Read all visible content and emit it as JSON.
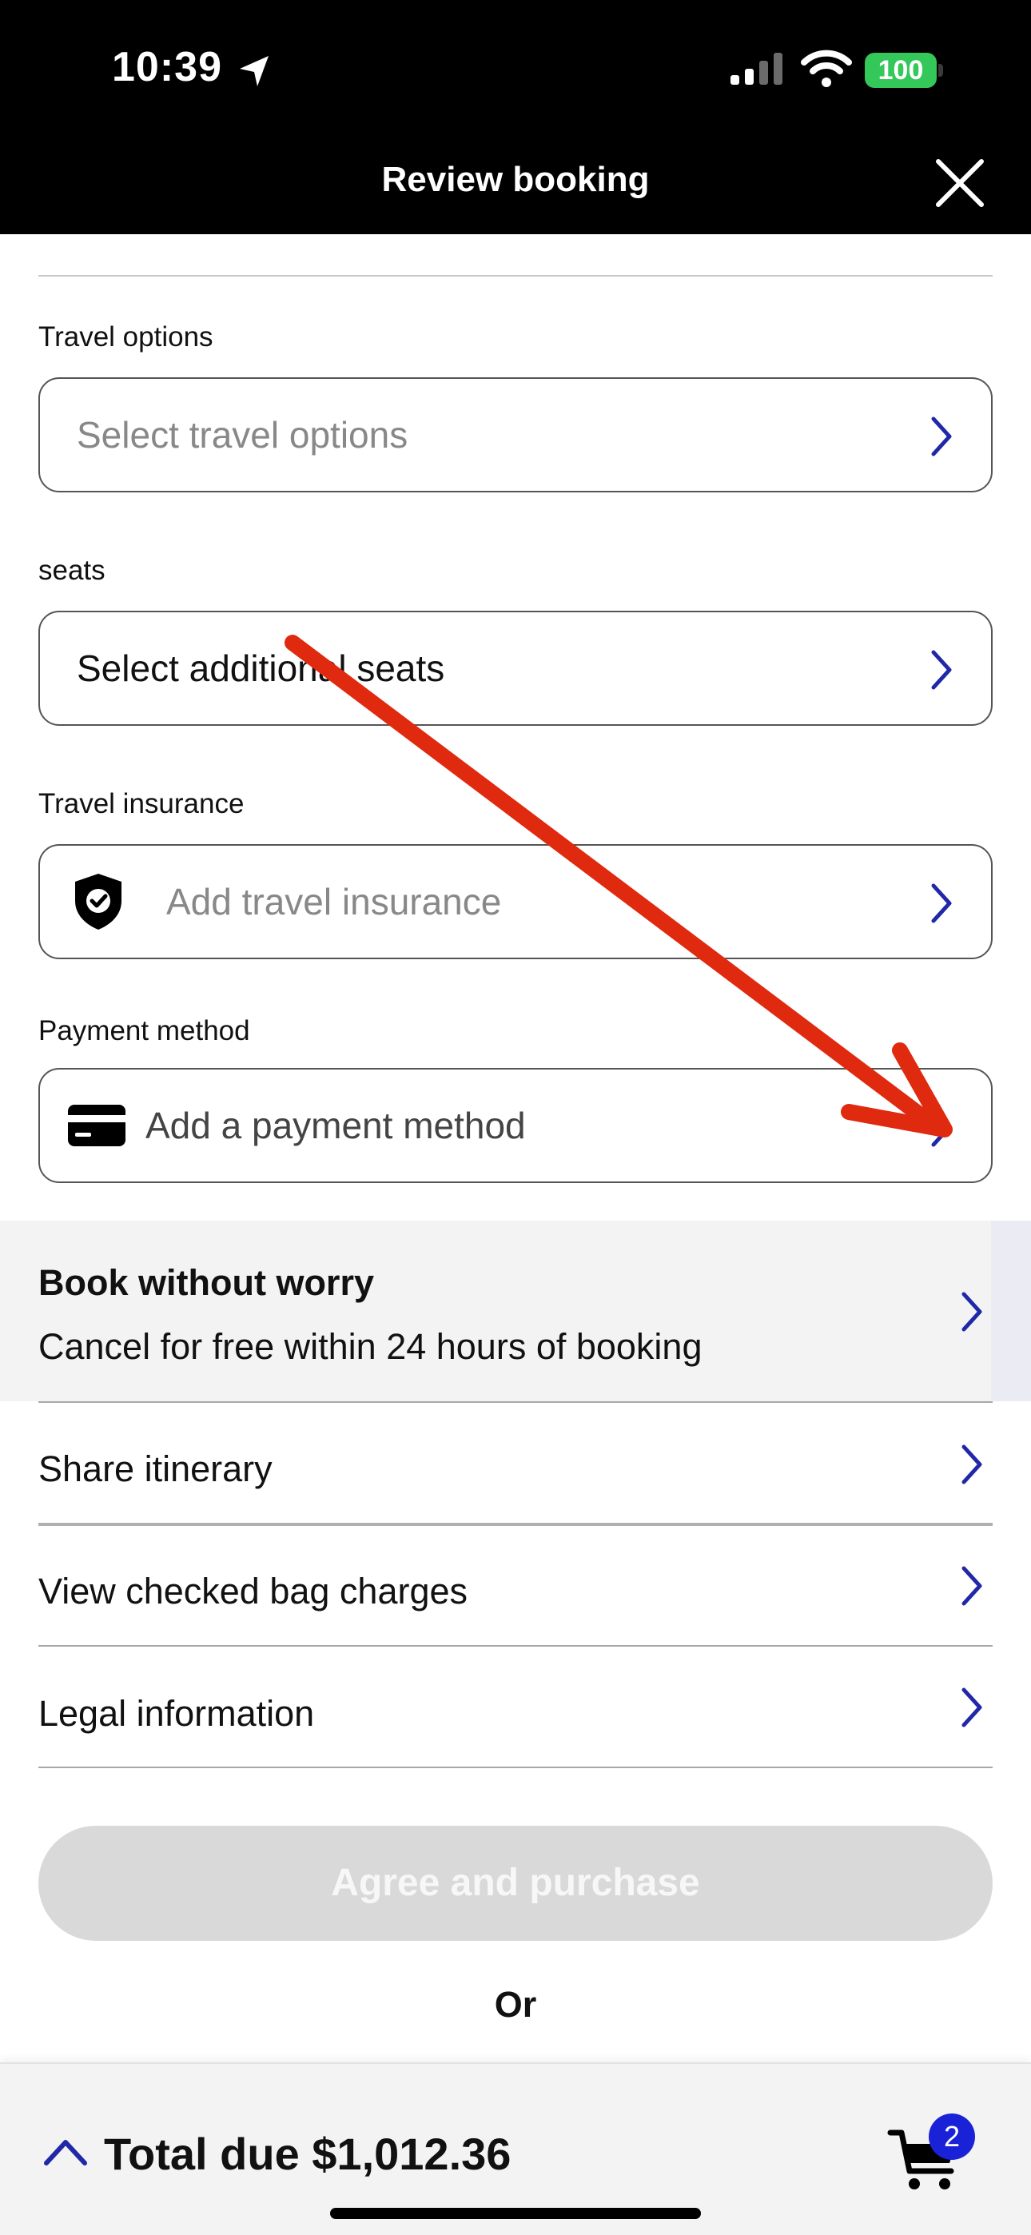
{
  "status_bar": {
    "time": "10:39",
    "battery": "100",
    "battery_color": "#34c759"
  },
  "header": {
    "title": "Review booking"
  },
  "form": {
    "travel_options": {
      "label": "Travel options",
      "placeholder": "Select travel options"
    },
    "seats": {
      "label": "seats",
      "value": "Select additional seats"
    },
    "travel_insurance": {
      "label": "Travel insurance",
      "placeholder": "Add travel insurance",
      "icon": "shield-check-icon"
    },
    "payment_method": {
      "label": "Payment method",
      "placeholder": "Add a payment method",
      "icon": "credit-card-icon"
    }
  },
  "promo": {
    "title": "Book without worry",
    "subtitle": "Cancel for free within 24 hours of booking"
  },
  "list": {
    "share_itinerary": "Share itinerary",
    "checked_bag": "View checked bag charges",
    "legal": "Legal information"
  },
  "actions": {
    "agree_label": "Agree and purchase",
    "or_label": "Or"
  },
  "bottom_bar": {
    "total_label": "Total due $1,012.36",
    "cart_count": "2"
  },
  "colors": {
    "accent": "#1a22d8",
    "chevron": "#2128a8",
    "annotation_arrow": "#e02a10",
    "disabled_button": "#d9d9d9"
  }
}
